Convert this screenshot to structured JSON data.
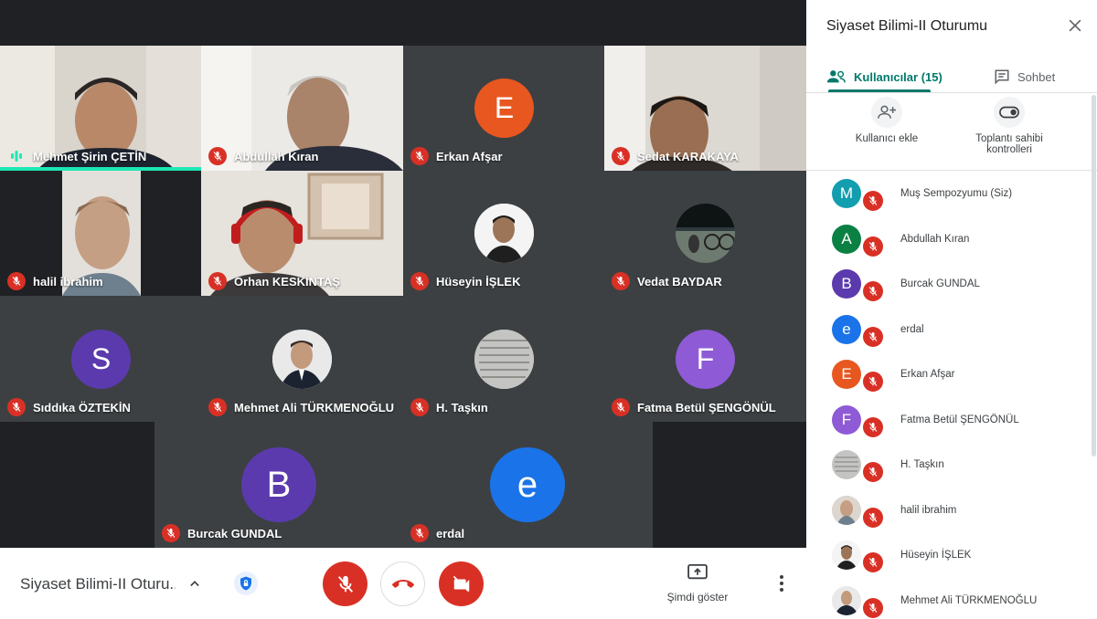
{
  "tiles": [
    {
      "name": "Mehmet Şirin ÇETİN",
      "speaking": true
    },
    {
      "name": "Abdullah Kıran"
    },
    {
      "name": "Erkan Afşar",
      "initial": "E",
      "color": "#e8571f"
    },
    {
      "name": "Sedat KARAKAYA"
    },
    {
      "name": "halil ibrahim"
    },
    {
      "name": "Orhan KESKİNTAŞ"
    },
    {
      "name": "Hüseyin İŞLEK"
    },
    {
      "name": "Vedat BAYDAR"
    },
    {
      "name": "Sıddıka ÖZTEKİN",
      "initial": "S",
      "color": "#5b3aad"
    },
    {
      "name": "Mehmet Ali TÜRKMENOĞLU"
    },
    {
      "name": "H. Taşkın"
    },
    {
      "name": "Fatma Betül ŞENGÖNÜL",
      "initial": "F",
      "color": "#8e5ad6"
    },
    {
      "name": "Burcak GUNDAL",
      "initial": "B",
      "color": "#5b3aad"
    },
    {
      "name": "erdal",
      "initial": "e",
      "color": "#1a73e8"
    }
  ],
  "bottombar": {
    "meeting_name": "Siyaset Bilimi-II Oturu...",
    "present_label": "Şimdi göster"
  },
  "panel": {
    "title": "Siyaset Bilimi-II Oturumu",
    "tab_users": "Kullanıcılar (15)",
    "tab_chat": "Sohbet",
    "add_user": "Kullanıcı ekle",
    "host_controls": "Toplantı sahibi kontrolleri",
    "participants": [
      {
        "name": "Muş Sempozyumu (Siz)",
        "initial": "M",
        "color": "#129eaf"
      },
      {
        "name": "Abdullah Kıran",
        "initial": "A",
        "color": "#0b8043"
      },
      {
        "name": "Burcak GUNDAL",
        "initial": "B",
        "color": "#5b3aad"
      },
      {
        "name": "erdal",
        "initial": "e",
        "color": "#1a73e8"
      },
      {
        "name": "Erkan Afşar",
        "initial": "E",
        "color": "#e8571f"
      },
      {
        "name": "Fatma Betül ŞENGÖNÜL",
        "initial": "F",
        "color": "#8e5ad6"
      },
      {
        "name": "H. Taşkın"
      },
      {
        "name": "halil ibrahim"
      },
      {
        "name": "Hüseyin İŞLEK"
      },
      {
        "name": "Mehmet Ali TÜRKMENOĞLU"
      }
    ]
  }
}
